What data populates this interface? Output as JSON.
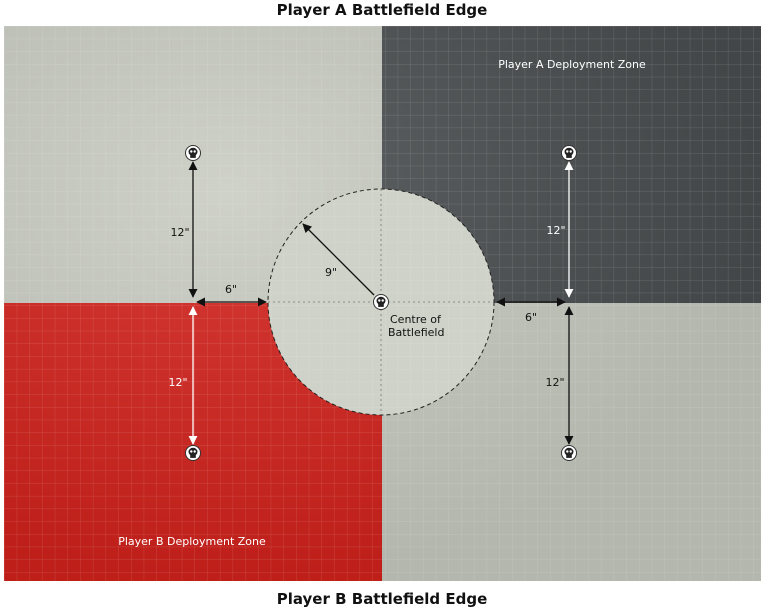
{
  "top_edge": "Player A Battlefield Edge",
  "bottom_edge": "Player B Battlefield Edge",
  "zones": {
    "player_a": "Player A Deployment Zone",
    "player_b": "Player B Deployment Zone"
  },
  "centre": {
    "line1": "Centre of",
    "line2": "Battlefield"
  },
  "distances": {
    "left_top": "12\"",
    "left_bottom": "12\"",
    "left_gap": "6\"",
    "radius": "9\"",
    "right_top": "12\"",
    "right_bottom": "12\"",
    "right_gap": "6\""
  },
  "colors": {
    "player_a_zone": "#4a4e50",
    "player_b_zone": "#d3221c",
    "neutral": "#c9ccc2",
    "no_mans_land_circle": "#cfd2c8"
  },
  "icons": [
    "skull-icon"
  ]
}
